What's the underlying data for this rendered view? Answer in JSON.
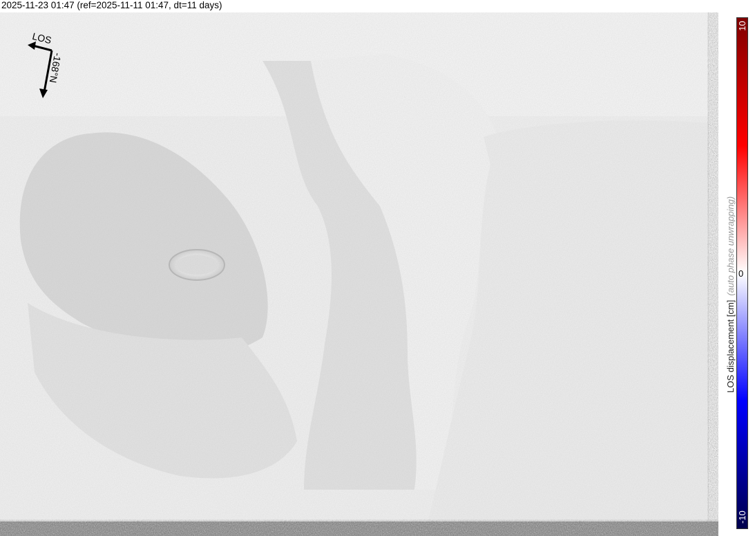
{
  "title": "2025-11-23 01:47 (ref=2025-11-11 01:47, dt=11 days)",
  "compass": {
    "los_label": "LOS",
    "heading_label": "-168°N"
  },
  "colorbar": {
    "max_label": "10",
    "zero_label": "0",
    "min_label": "-10",
    "label": "LOS displacement [cm]",
    "note": "(auto phase unwrapping)",
    "colors": [
      "#00004c",
      "#0000ff",
      "#ffffff",
      "#ff0000",
      "#7f0000"
    ]
  }
}
